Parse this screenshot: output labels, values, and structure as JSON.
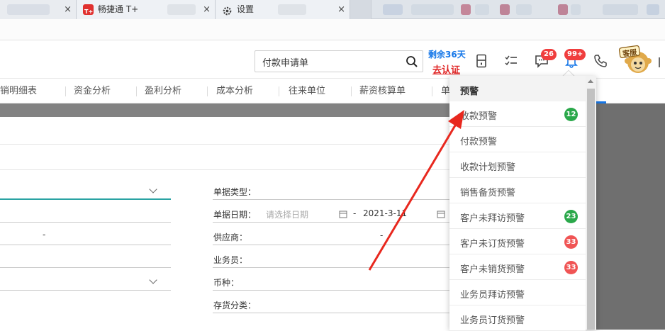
{
  "browser": {
    "tabs": [
      {
        "label": "畅捷通 T+",
        "icon": "tplus-logo-icon",
        "close": "×"
      },
      {
        "label": "设置",
        "icon": "gear-icon",
        "close": "×"
      }
    ],
    "first_tab_close": "×",
    "last_tab_close": "×"
  },
  "header": {
    "search_value": "付款申请单",
    "trial_text": "剩余36天",
    "cert_link": "去认证",
    "message_badge": "26",
    "alert_badge": "99+",
    "kefu_label": "客服"
  },
  "nav": {
    "items": [
      "销明细表",
      "资金分析",
      "盈利分析",
      "成本分析",
      "往来单位",
      "薪资核算单",
      "单"
    ]
  },
  "form": {
    "left_dash": "-",
    "fields": [
      {
        "label": "单据类型："
      },
      {
        "label": "单据日期：",
        "placeholder": "请选择日期",
        "dash": "-",
        "value": "2021-3-11"
      },
      {
        "label": "供应商：",
        "dash": "-"
      },
      {
        "label": "业务员："
      },
      {
        "label": "币种："
      },
      {
        "label": "存货分类："
      }
    ]
  },
  "dropdown": {
    "title": "预警",
    "items": [
      {
        "label": "收款预警",
        "count": "12",
        "color": "#2aa84a"
      },
      {
        "label": "付款预警",
        "count": "",
        "color": ""
      },
      {
        "label": "收款计划预警",
        "count": "",
        "color": ""
      },
      {
        "label": "销售备货预警",
        "count": "",
        "color": ""
      },
      {
        "label": "客户未拜访预警",
        "count": "23",
        "color": "#2aa84a"
      },
      {
        "label": "客户未订货预警",
        "count": "33",
        "color": "#f05454"
      },
      {
        "label": "客户未销货预警",
        "count": "33",
        "color": "#f05454"
      },
      {
        "label": "业务员拜访预警",
        "count": "",
        "color": ""
      },
      {
        "label": "业务员订货预警",
        "count": "",
        "color": ""
      }
    ]
  },
  "colors": {
    "accent_blue": "#1677e8",
    "badge_red": "#f03e3e",
    "annotation_arrow": "#e8281e"
  }
}
